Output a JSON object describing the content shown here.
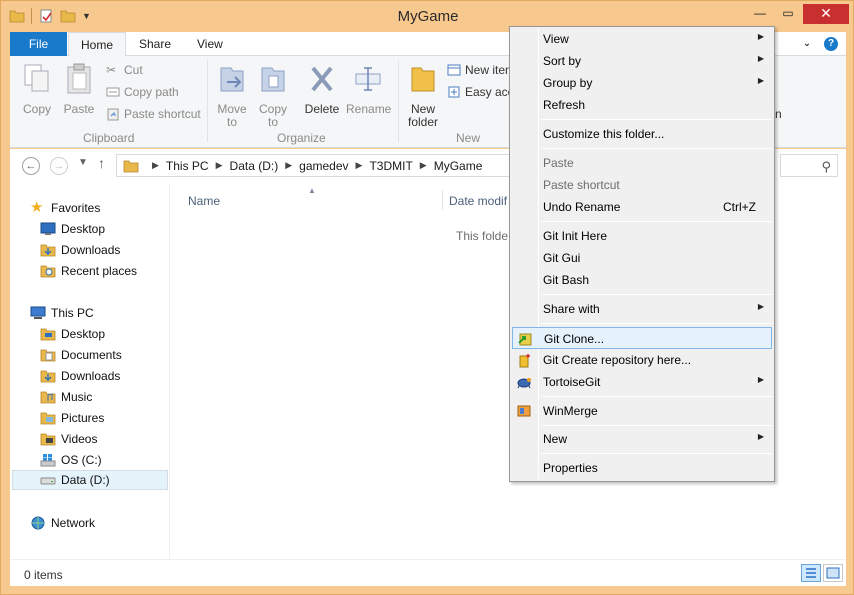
{
  "window": {
    "title": "MyGame",
    "controls": {
      "minimize": "—",
      "maximize": "▭",
      "close": "✕"
    }
  },
  "ribbon_tabs": {
    "file": "File",
    "home": "Home",
    "share": "Share",
    "view": "View"
  },
  "ribbon": {
    "clipboard": {
      "group_label": "Clipboard",
      "copy": "Copy",
      "paste": "Paste",
      "cut": "Cut",
      "copy_path": "Copy path",
      "paste_shortcut": "Paste shortcut"
    },
    "organize": {
      "group_label": "Organize",
      "move_to": "Move to",
      "copy_to": "Copy to",
      "delete": "Delete",
      "rename": "Rename"
    },
    "new": {
      "group_label": "New",
      "new_folder": "New folder",
      "new_item": "New iten",
      "easy_access": "Easy acc"
    },
    "cut_off_label": "n"
  },
  "address_bar": {
    "crumbs": [
      "This PC",
      "Data (D:)",
      "gamedev",
      "T3DMIT",
      "MyGame"
    ]
  },
  "nav_pane": {
    "favorites": {
      "label": "Favorites",
      "items": [
        "Desktop",
        "Downloads",
        "Recent places"
      ]
    },
    "this_pc": {
      "label": "This PC",
      "items": [
        "Desktop",
        "Documents",
        "Downloads",
        "Music",
        "Pictures",
        "Videos",
        "OS (C:)",
        "Data (D:)"
      ]
    },
    "network": {
      "label": "Network"
    }
  },
  "content": {
    "col_name": "Name",
    "col_date": "Date modif",
    "empty_message": "This folde"
  },
  "status_bar": {
    "item_count": "0 items"
  },
  "context_menu": {
    "items": [
      {
        "label": "View",
        "submenu": true
      },
      {
        "label": "Sort by",
        "submenu": true
      },
      {
        "label": "Group by",
        "submenu": true
      },
      {
        "label": "Refresh"
      },
      {
        "label": "Customize this folder..."
      },
      {
        "label": "Paste",
        "disabled": true
      },
      {
        "label": "Paste shortcut",
        "disabled": true
      },
      {
        "label": "Undo Rename",
        "shortcut": "Ctrl+Z"
      },
      {
        "label": "Git Init Here"
      },
      {
        "label": "Git Gui"
      },
      {
        "label": "Git Bash"
      },
      {
        "label": "Share with",
        "submenu": true
      },
      {
        "label": "Git Clone...",
        "icon": "git-clone-icon",
        "highlighted": true
      },
      {
        "label": "Git Create repository here...",
        "icon": "git-create-repo-icon"
      },
      {
        "label": "TortoiseGit",
        "icon": "tortoisegit-icon",
        "submenu": true
      },
      {
        "label": "WinMerge",
        "icon": "winmerge-icon"
      },
      {
        "label": "New",
        "submenu": true
      },
      {
        "label": "Properties"
      }
    ]
  },
  "colors": {
    "frame": "#f7c98f",
    "file_tab": "#1979ca",
    "close_button": "#c7302e",
    "menu_highlight": "#e5f1fb"
  }
}
